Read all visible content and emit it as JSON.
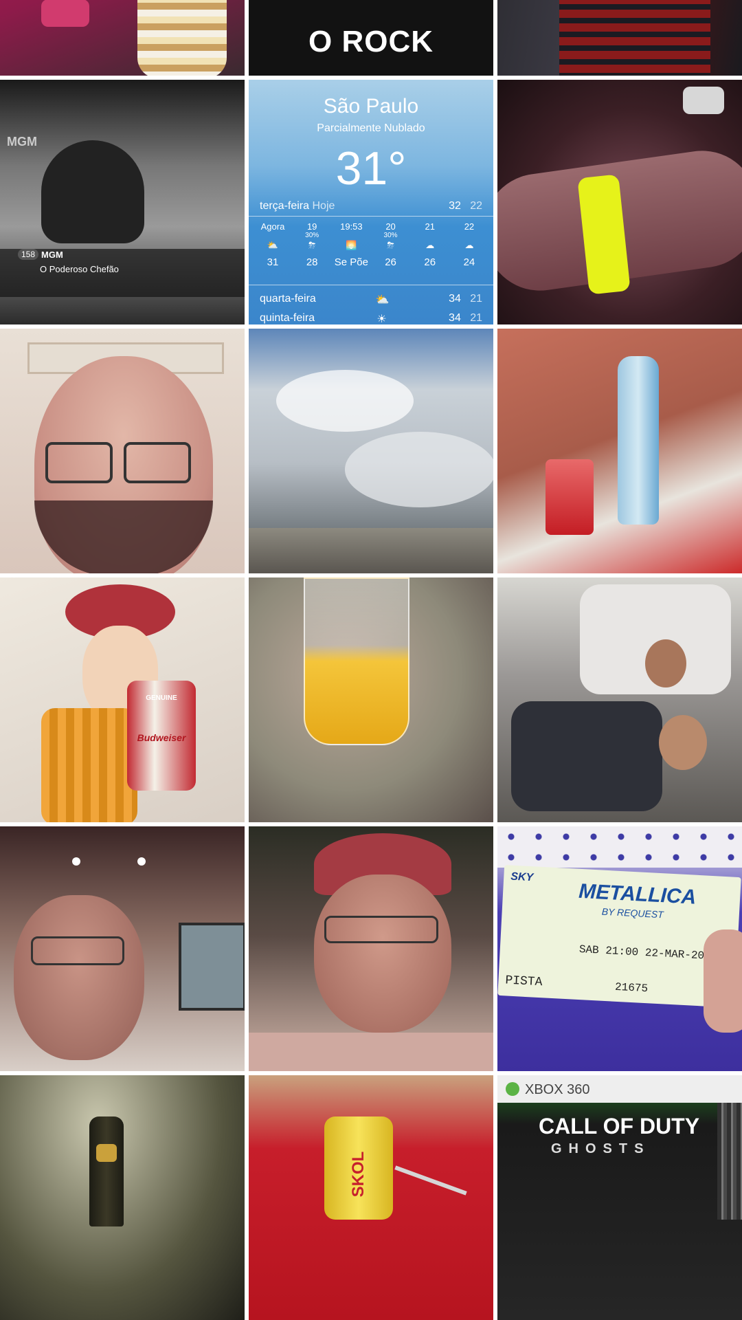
{
  "photos": {
    "rock": {
      "text": "O ROCK"
    },
    "tv": {
      "channel_number": "158",
      "channel": "MGM",
      "program": "O Poderoso Chefão",
      "logo": "MGM"
    },
    "weather": {
      "city": "São Paulo",
      "condition": "Parcialmente Nublado",
      "temperature": "31°",
      "today": {
        "day": "terça-feira",
        "label": "Hoje",
        "high": "32",
        "low": "22"
      },
      "hourly": [
        {
          "time": "Agora",
          "sub": "",
          "icon": "partly-sunny-icon",
          "value": "31"
        },
        {
          "time": "19",
          "sub": "30%",
          "icon": "thunderstorm-icon",
          "value": "28"
        },
        {
          "time": "19:53",
          "sub": "",
          "icon": "sunset-icon",
          "value": "Se Põe"
        },
        {
          "time": "20",
          "sub": "30%",
          "icon": "thunderstorm-icon",
          "value": "26"
        },
        {
          "time": "21",
          "sub": "",
          "icon": "partly-cloudy-night-icon",
          "value": "26"
        },
        {
          "time": "22",
          "sub": "",
          "icon": "partly-cloudy-night-icon",
          "value": "24"
        }
      ],
      "forecast": [
        {
          "day": "quarta-feira",
          "icon": "partly-sunny-icon",
          "high": "34",
          "low": "21"
        },
        {
          "day": "quinta-feira",
          "icon": "sunny-icon",
          "high": "34",
          "low": "21"
        }
      ]
    },
    "woody": {
      "brand": "Budweiser",
      "tag": "GENUINE"
    },
    "ticket": {
      "brand": "SKY",
      "band": "METALLICA",
      "subtitle": "BY REQUEST",
      "date": "SAB 21:00 22-MAR-2014",
      "sector": "PISTA",
      "number": "21675"
    },
    "skol": {
      "brand": "SKOL"
    },
    "xbox": {
      "console": "XBOX 360",
      "title": "CALL OF DUTY",
      "subtitle": "GHOSTS"
    }
  },
  "colors": {
    "background": "#ffffff",
    "weather_blue": "#3d8fd2",
    "wristband": "#e6f21a",
    "ticket_purple": "#3d2f9e"
  }
}
